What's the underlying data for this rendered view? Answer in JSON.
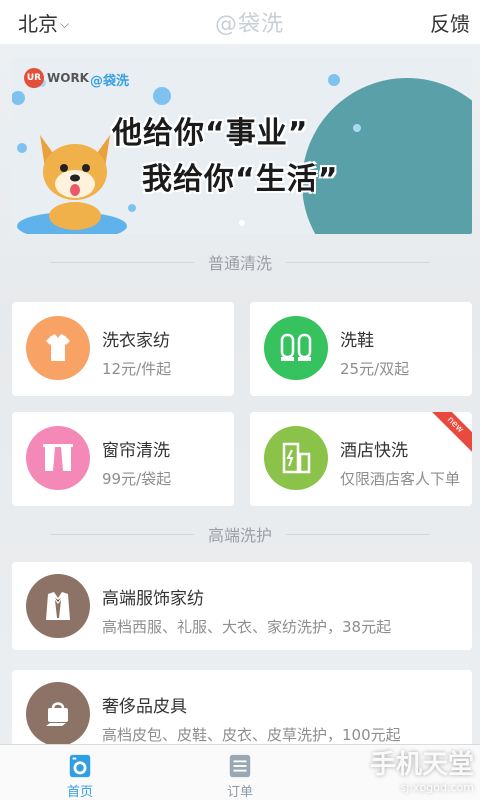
{
  "header": {
    "city": "北京",
    "brand": "@袋洗",
    "feedback": "反馈"
  },
  "banner": {
    "logo_ur": "UR",
    "logo_work": "WORK",
    "logo_brand": "@袋洗",
    "line1": "他给你“事业”",
    "line2": "我给你“生活”",
    "slide_index": 1,
    "slide_count": 1
  },
  "sections": {
    "normal": "普通清洗",
    "premium": "高端洗护"
  },
  "services_normal": [
    {
      "title": "洗衣家纺",
      "sub": "12元/件起",
      "icon": "shirt-icon",
      "color": "#f8a265"
    },
    {
      "title": "洗鞋",
      "sub": "25元/双起",
      "icon": "shoes-icon",
      "color": "#36c35f"
    },
    {
      "title": "窗帘清洗",
      "sub": "99元/袋起",
      "icon": "curtain-icon",
      "color": "#f489b7"
    },
    {
      "title": "酒店快洗",
      "sub": "仅限酒店客人下单",
      "icon": "hotel-icon",
      "color": "#8bc34a",
      "badge": "new"
    }
  ],
  "services_premium": [
    {
      "title": "高端服饰家纺",
      "sub": "高档西服、礼服、大衣、家纺洗护，38元起",
      "icon": "suit-icon",
      "color": "#8c7366"
    },
    {
      "title": "奢侈品皮具",
      "sub": "高档皮包、皮鞋、皮衣、皮草洗护，100元起",
      "icon": "handbag-icon",
      "color": "#8c7366"
    }
  ],
  "tabs": [
    {
      "label": "首页",
      "icon": "washer-icon",
      "active": true
    },
    {
      "label": "订单",
      "icon": "list-icon",
      "active": false
    }
  ],
  "watermark": {
    "title": "手机天堂",
    "url": "sj.xpgod.com"
  },
  "colors": {
    "accent": "#2f9ee5",
    "badge": "#e84a3d"
  }
}
